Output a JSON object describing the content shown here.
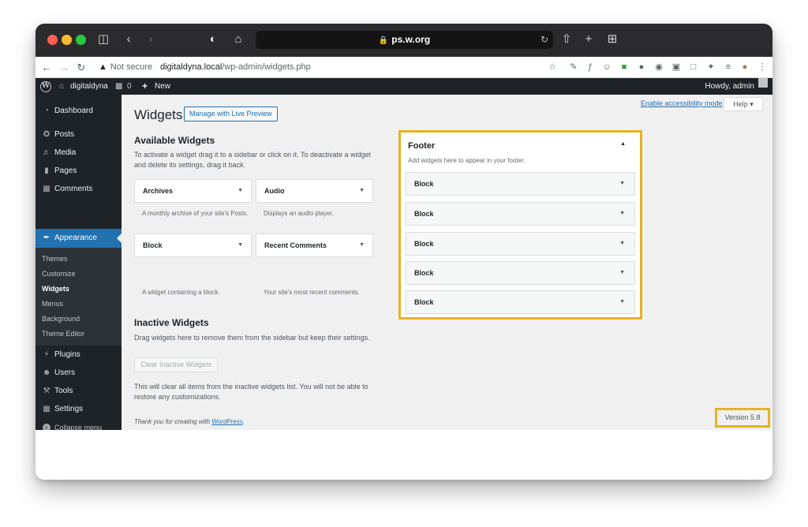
{
  "browser": {
    "url_host": "ps.w.org",
    "address": {
      "security": "Not secure",
      "host": "digitaldyna.local",
      "path": "/wp-admin/widgets.php"
    }
  },
  "adminbar": {
    "site_name": "digitaldyna",
    "comments_count": "0",
    "new_label": "New",
    "greeting": "Howdy, admin"
  },
  "sidebar": {
    "items_top": [
      {
        "label": "Dashboard",
        "icon": "dashboard-icon"
      },
      {
        "label": "Posts",
        "icon": "pin-icon"
      },
      {
        "label": "Media",
        "icon": "media-icon"
      },
      {
        "label": "Pages",
        "icon": "page-icon"
      },
      {
        "label": "Comments",
        "icon": "comment-icon"
      }
    ],
    "active": {
      "label": "Appearance",
      "icon": "brush-icon"
    },
    "submenu": [
      "Themes",
      "Customize",
      "Widgets",
      "Menus",
      "Background",
      "Theme Editor"
    ],
    "items_bottom": [
      {
        "label": "Plugins",
        "icon": "plug-icon"
      },
      {
        "label": "Users",
        "icon": "user-icon"
      },
      {
        "label": "Tools",
        "icon": "wrench-icon"
      },
      {
        "label": "Settings",
        "icon": "settings-icon"
      }
    ],
    "collapse_label": "Collapse menu"
  },
  "content": {
    "title": "Widgets",
    "live_preview_label": "Manage with Live Preview",
    "accessibility_link": "Enable accessibility mode",
    "help_label": "Help",
    "available": {
      "title": "Available Widgets",
      "desc": "To activate a widget drag it to a sidebar or click on it. To deactivate a widget and delete its settings, drag it back.",
      "widgets": [
        {
          "name": "Archives",
          "desc": "A monthly archive of your site's Posts."
        },
        {
          "name": "Audio",
          "desc": "Displays an audio player."
        },
        {
          "name": "Block",
          "desc": "A widget containing a block."
        },
        {
          "name": "Recent Comments",
          "desc": "Your site's most recent comments."
        }
      ]
    },
    "inactive": {
      "title": "Inactive Widgets",
      "desc": "Drag widgets here to remove them from the sidebar but keep their settings.",
      "clear_label": "Clear Inactive Widgets",
      "clear_note": "This will clear all items from the inactive widgets list. You will not be able to restore any customizations."
    },
    "footer_area": {
      "title": "Footer",
      "desc": "Add widgets here to appear in your footer.",
      "blocks": [
        "Block",
        "Block",
        "Block",
        "Block",
        "Block"
      ]
    },
    "footer_credit": "Thank you for creating with ",
    "footer_link": "WordPress",
    "footer_period": ".",
    "version": "Version 5.8"
  }
}
